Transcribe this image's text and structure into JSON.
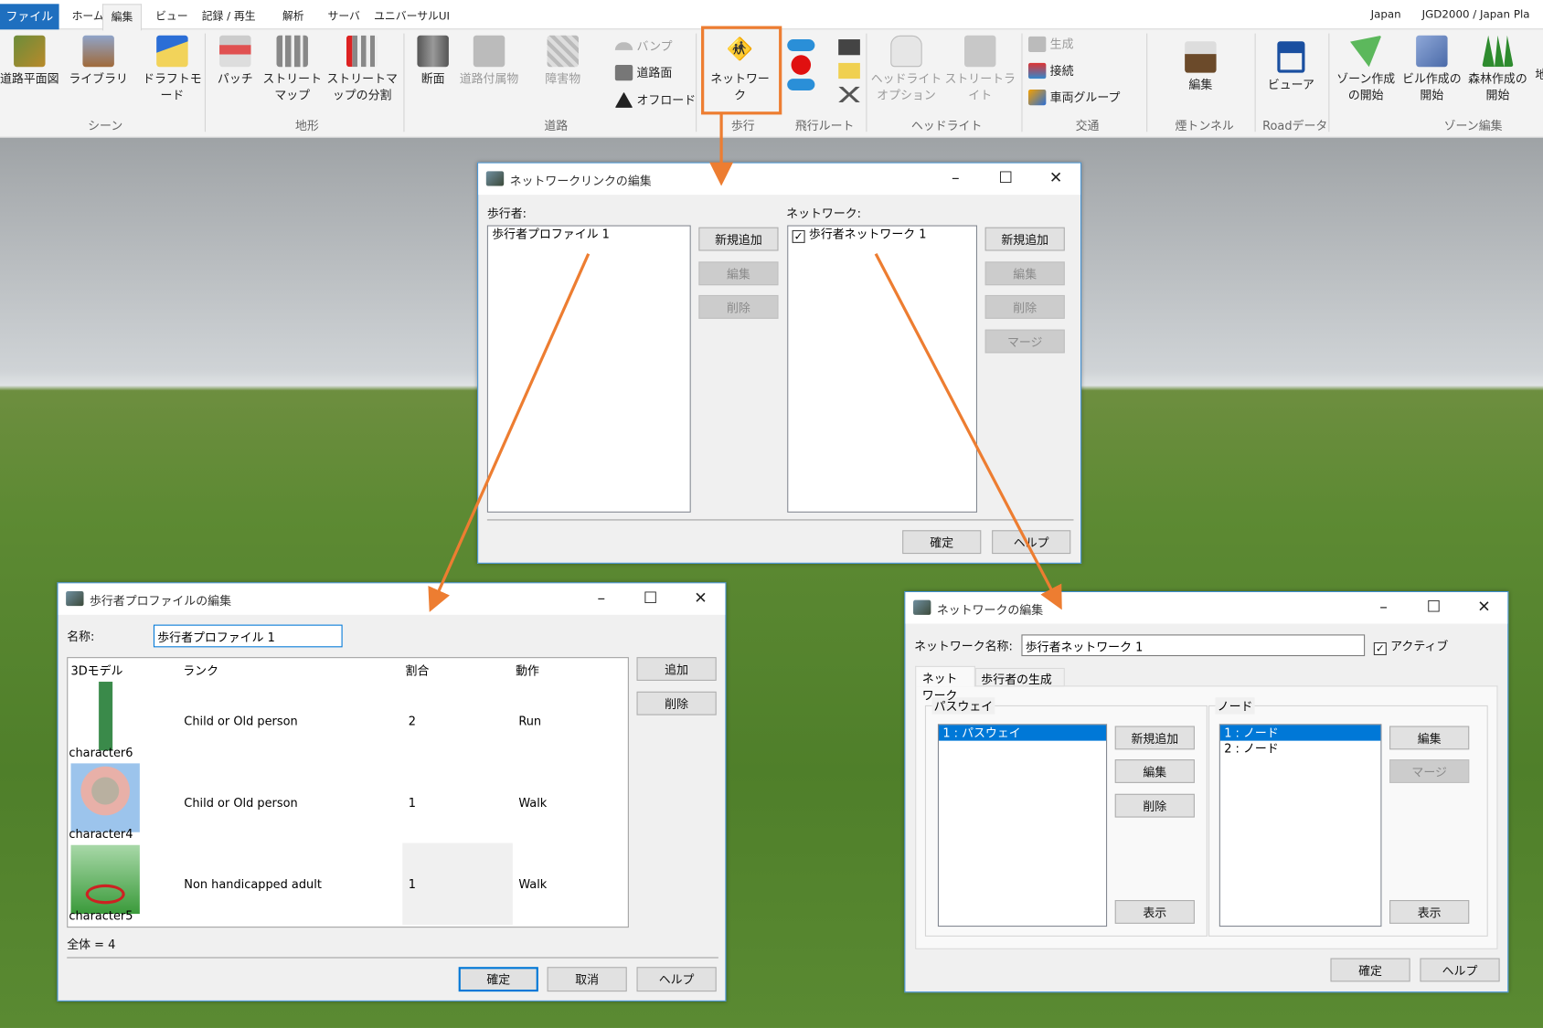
{
  "ribbon": {
    "tabs": [
      "ファイル",
      "ホーム",
      "編集",
      "ビュー",
      "記録 / 再生",
      "解析",
      "サーバ",
      "ユニバーサルUI"
    ],
    "active_tab": "編集",
    "status": {
      "region": "Japan",
      "crs": "JGD2000 / Japan Pla"
    },
    "groups": {
      "scene": "シーン",
      "terrain": "地形",
      "road": "道路",
      "walk": "歩行",
      "flight": "飛行ルート",
      "headlight": "ヘッドライト",
      "traffic": "交通",
      "smoke": "煙トンネル",
      "roaddata": "Roadデータ",
      "zone": "ゾーン編集"
    },
    "buttons": {
      "road_plan": "道路平面図",
      "library": "ライブラリ",
      "draft": "ドラフトモード",
      "patch": "パッチ",
      "streetmap": "ストリートマップ",
      "streetmap_split": "ストリートマップの分割",
      "section": "断面",
      "road_furniture": "道路付属物",
      "obstacle": "障害物",
      "bump": "バンプ",
      "road_surface": "道路面",
      "offroad": "オフロード",
      "network": "ネットワーク",
      "headlight_opt": "ヘッドライトオプション",
      "streetlight": "ストリートライト",
      "generate": "生成",
      "connect": "接続",
      "vehicle_group": "車両グループ",
      "smoke_edit": "編集",
      "viewer": "ビューア",
      "zone_start": "ゾーン作成の開始",
      "building_start": "ビル作成の開始",
      "forest_start": "森林作成の開始",
      "partial": "地"
    }
  },
  "highlight_color": "#ED7D31",
  "link_dialog": {
    "title": "ネットワークリンクの編集",
    "pedestrian_label": "歩行者:",
    "pedestrian_items": [
      "歩行者プロファイル 1"
    ],
    "network_label": "ネットワーク:",
    "network_items": [
      {
        "label": "歩行者ネットワーク 1",
        "checked": true
      }
    ],
    "buttons": {
      "add": "新規追加",
      "edit": "編集",
      "delete": "削除",
      "merge": "マージ",
      "ok": "確定",
      "help": "ヘルプ"
    }
  },
  "profile_dialog": {
    "title": "歩行者プロファイルの編集",
    "name_label": "名称:",
    "name_value": "歩行者プロファイル 1",
    "columns": [
      "3Dモデル",
      "ランク",
      "割合",
      "動作"
    ],
    "rows": [
      {
        "model": "character6",
        "rank": "Child or Old person",
        "ratio": "2",
        "action": "Run"
      },
      {
        "model": "character4",
        "rank": "Child or Old person",
        "ratio": "1",
        "action": "Walk"
      },
      {
        "model": "character5",
        "rank": "Non handicapped adult",
        "ratio": "1",
        "action": "Walk"
      }
    ],
    "total": "全体 = 4",
    "buttons": {
      "add": "追加",
      "delete": "削除",
      "ok": "確定",
      "cancel": "取消",
      "help": "ヘルプ"
    }
  },
  "network_dialog": {
    "title": "ネットワークの編集",
    "name_label": "ネットワーク名称:",
    "name_value": "歩行者ネットワーク 1",
    "active_label": "アクティブ",
    "active": true,
    "tabs": [
      "ネットワーク",
      "歩行者の生成"
    ],
    "pathway_label": "パスウェイ",
    "pathways": [
      "1 : パスウェイ"
    ],
    "node_label": "ノード",
    "nodes": [
      "1 : ノード",
      "2 : ノード"
    ],
    "buttons": {
      "add": "新規追加",
      "edit": "編集",
      "delete": "削除",
      "show": "表示",
      "merge": "マージ",
      "ok": "確定",
      "help": "ヘルプ"
    }
  }
}
